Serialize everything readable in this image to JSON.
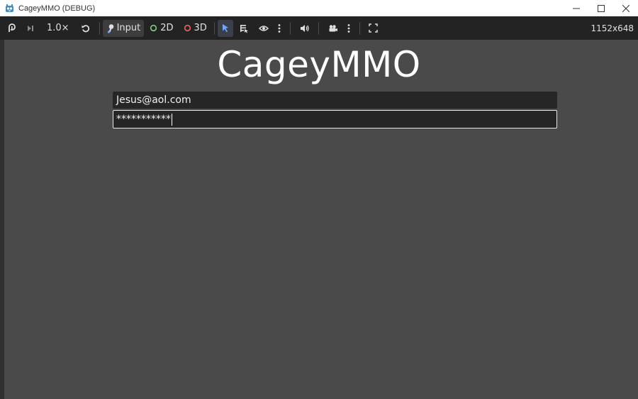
{
  "window": {
    "title": "CageyMMO (DEBUG)"
  },
  "toolbar": {
    "speed": "1.0×",
    "input_label": "Input",
    "mode_2d": "2D",
    "mode_3d": "3D",
    "resolution": "1152x648"
  },
  "game": {
    "title": "CageyMMO",
    "email_value": "Jesus@aol.com",
    "password_value": "***********"
  },
  "colors": {
    "toolbar_bg": "#232323",
    "viewport_bg": "#4a4a4a",
    "accent_blue": "#6ea6ff",
    "mode_2d_ring": "#7fd17f",
    "mode_3d_ring": "#f06262"
  }
}
